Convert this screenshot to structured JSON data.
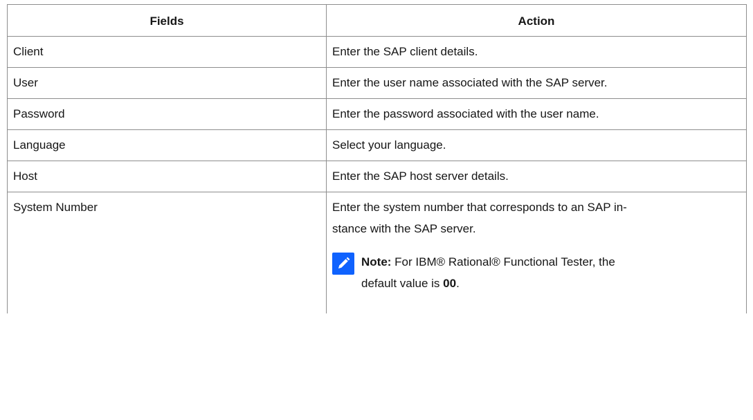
{
  "table": {
    "headers": {
      "fields": "Fields",
      "action": "Action"
    },
    "rows": [
      {
        "field": "Client",
        "action": "Enter the SAP client details."
      },
      {
        "field": "User",
        "action": "Enter the user name associated with the SAP server."
      },
      {
        "field": "Password",
        "action": "Enter the password associated with the user name."
      },
      {
        "field": "Language",
        "action": "Select your language."
      },
      {
        "field": "Host",
        "action": "Enter the SAP host server details."
      },
      {
        "field": "System Number",
        "action_line1": "Enter the system number that corresponds to an SAP in-",
        "action_line2": "stance with the SAP server.",
        "note": {
          "icon": "pencil-note-icon",
          "label": "Note:",
          "text_line1": " For IBM® Rational® Functional Tester, the",
          "text_line2": "default value is ",
          "value": "00",
          "suffix": "."
        }
      }
    ]
  },
  "colors": {
    "note_icon_bg": "#0f62fe",
    "border": "#8d8d8d",
    "text": "#161616"
  }
}
